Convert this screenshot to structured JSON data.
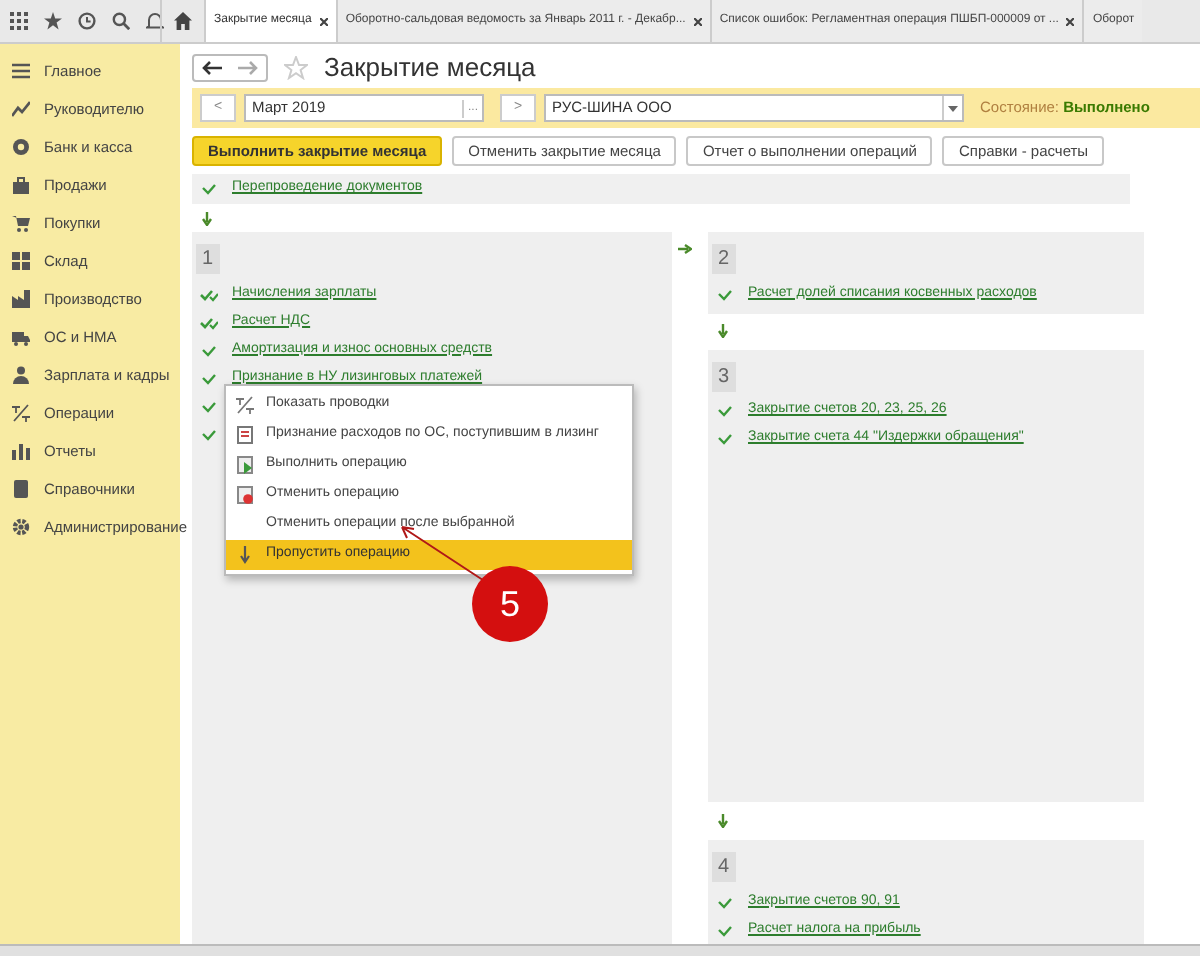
{
  "toolbar_tabs": [
    {
      "label": "Закрытие месяца",
      "selected": true,
      "closable": true
    },
    {
      "label": "Оборотно-сальдовая ведомость за Январь 2011 г. - Декабр...",
      "selected": false,
      "closable": true
    },
    {
      "label": "Список ошибок: Регламентная операция ПШБП-000009 от ...",
      "selected": false,
      "closable": true
    },
    {
      "label": "Оборот",
      "selected": false,
      "closable": false
    }
  ],
  "sidebar": {
    "items": [
      {
        "label": "Главное",
        "kind": "menu"
      },
      {
        "label": "Руководителю",
        "kind": "chart"
      },
      {
        "label": "Банк и касса",
        "kind": "coin"
      },
      {
        "label": "Продажи",
        "kind": "bag"
      },
      {
        "label": "Покупки",
        "kind": "cart"
      },
      {
        "label": "Склад",
        "kind": "grid"
      },
      {
        "label": "Производство",
        "kind": "factory"
      },
      {
        "label": "ОС и НМА",
        "kind": "truck"
      },
      {
        "label": "Зарплата и кадры",
        "kind": "person"
      },
      {
        "label": "Операции",
        "kind": "dtkt"
      },
      {
        "label": "Отчеты",
        "kind": "bars"
      },
      {
        "label": "Справочники",
        "kind": "book"
      },
      {
        "label": "Администрирование",
        "kind": "gear"
      }
    ]
  },
  "title": "Закрытие месяца",
  "period": {
    "prev": "<",
    "value": "Март 2019",
    "choose": "...",
    "next": ">"
  },
  "organization": {
    "value": "РУС-ШИНА ООО"
  },
  "state": {
    "label": "Состояние:",
    "value": "Выполнено"
  },
  "buttons": [
    {
      "label": "Выполнить закрытие месяца",
      "primary": true
    },
    {
      "label": "Отменить закрытие месяца",
      "primary": false
    },
    {
      "label": "Отчет о выполнении операций",
      "primary": false
    },
    {
      "label": "Справки - расчеты",
      "primary": false
    }
  ],
  "pre_step": {
    "label": "Перепроведение документов",
    "kind": "check"
  },
  "blocks": [
    {
      "number": "1",
      "items": [
        {
          "label": "Начисления зарплаты",
          "kind": "check-double"
        },
        {
          "label": "Расчет НДС",
          "kind": "check-double"
        },
        {
          "label": "Амортизация и износ основных средств",
          "kind": "check"
        },
        {
          "label": "Признание в НУ лизинговых платежей",
          "kind": "check"
        },
        {
          "kind": "check"
        },
        {
          "kind": "check"
        }
      ]
    },
    {
      "number": "2",
      "items": [
        {
          "label": "Расчет долей списания косвенных расходов",
          "kind": "check"
        }
      ]
    },
    {
      "number": "3",
      "items": [
        {
          "label": "Закрытие счетов 20, 23, 25, 26",
          "kind": "check"
        },
        {
          "label": "Закрытие счета 44 \"Издержки обращения\"",
          "kind": "check"
        }
      ]
    },
    {
      "number": "4",
      "items": [
        {
          "label": "Закрытие счетов 90, 91",
          "kind": "check"
        },
        {
          "label": "Расчет налога на прибыль",
          "kind": "check"
        }
      ]
    }
  ],
  "context_menu": [
    {
      "label": "Показать проводки",
      "kind": "dtkt",
      "selected": false
    },
    {
      "label": "Признание расходов по ОС, поступившим в лизинг",
      "kind": "doc",
      "selected": false
    },
    {
      "label": "Выполнить операцию",
      "kind": "run",
      "selected": false
    },
    {
      "label": "Отменить операцию",
      "kind": "cancel",
      "selected": false
    },
    {
      "label": "Отменить операции после выбранной",
      "kind": "none",
      "selected": false
    },
    {
      "label": "Пропустить операцию",
      "kind": "skip",
      "selected": true
    }
  ],
  "callout": {
    "label": "5"
  }
}
